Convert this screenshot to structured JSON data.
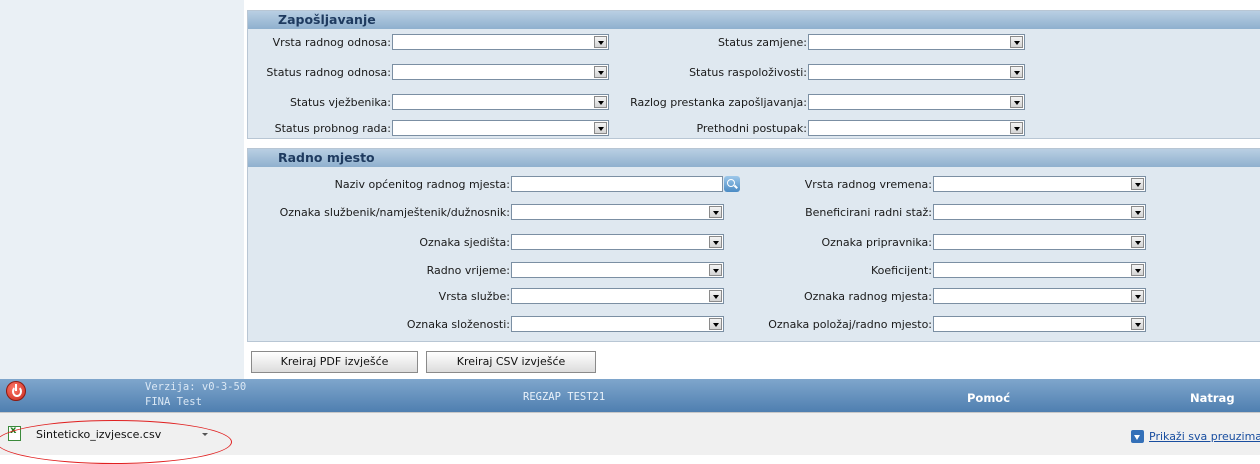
{
  "employment": {
    "title": "Zapošljavanje",
    "left_fields": [
      {
        "label": "Vrsta radnog odnosa:",
        "value": ""
      },
      {
        "label": "Status radnog odnosa:",
        "value": ""
      },
      {
        "label": "Status vježbenika:",
        "value": ""
      },
      {
        "label": "Status probnog rada:",
        "value": ""
      }
    ],
    "right_fields": [
      {
        "label": "Status zamjene:",
        "value": ""
      },
      {
        "label": "Status raspoloživosti:",
        "value": ""
      },
      {
        "label": "Razlog prestanka zapošljavanja:",
        "value": ""
      },
      {
        "label": "Prethodni postupak:",
        "value": ""
      }
    ]
  },
  "workplace": {
    "title": "Radno mjesto",
    "left_fields": [
      {
        "label": "Naziv općenitog radnog mjesta:",
        "value": ""
      },
      {
        "label": "Oznaka službenik/namještenik/dužnosnik:",
        "value": ""
      },
      {
        "label": "Oznaka sjedišta:",
        "value": ""
      },
      {
        "label": "Radno vrijeme:",
        "value": ""
      },
      {
        "label": "Vrsta službe:",
        "value": ""
      },
      {
        "label": "Oznaka složenosti:",
        "value": ""
      }
    ],
    "right_fields": [
      {
        "label": "Vrsta radnog vremena:",
        "value": ""
      },
      {
        "label": "Beneficirani radni staž:",
        "value": ""
      },
      {
        "label": "Oznaka pripravnika:",
        "value": ""
      },
      {
        "label": "Koeficijent:",
        "value": ""
      },
      {
        "label": "Oznaka radnog mjesta:",
        "value": ""
      },
      {
        "label": "Oznaka položaj/radno mjesto:",
        "value": ""
      }
    ]
  },
  "actions": {
    "pdf_label": "Kreiraj PDF izvješće",
    "csv_label": "Kreiraj CSV izvješće"
  },
  "footer": {
    "version": "Verzija: v0-3-50",
    "org": "FINA Test",
    "user": "REGZAP TEST21",
    "help": "Pomoć",
    "back": "Natrag"
  },
  "downloads": {
    "file_name": "Sinteticko_izvjesce.csv",
    "show_all": "Prikaži sva preuzimanja",
    "icons": {
      "file": "excel-csv-icon",
      "show_all": "download-arrow-icon"
    },
    "highlight_color": "#e02020"
  }
}
